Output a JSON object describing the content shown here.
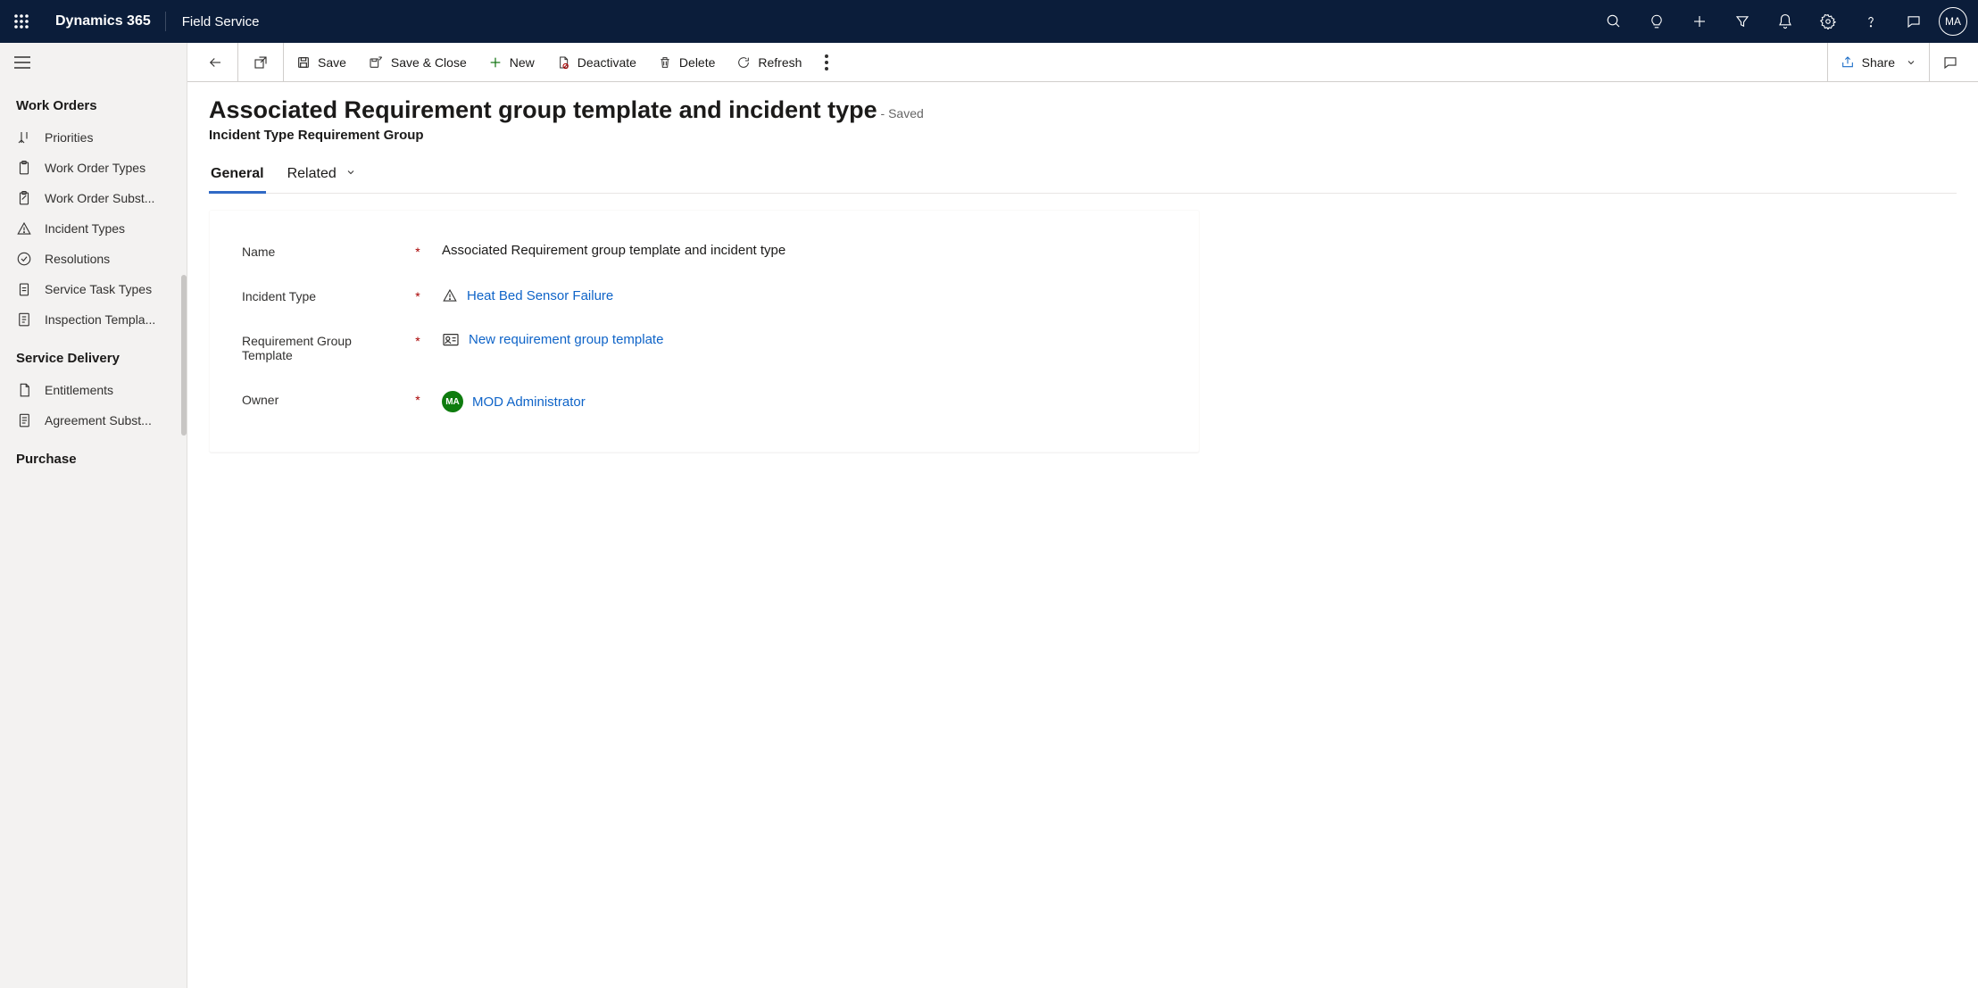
{
  "topnav": {
    "brand": "Dynamics 365",
    "module": "Field Service",
    "avatar_initials": "MA"
  },
  "commandBar": {
    "save": "Save",
    "saveClose": "Save & Close",
    "new": "New",
    "deactivate": "Deactivate",
    "delete": "Delete",
    "refresh": "Refresh",
    "share": "Share"
  },
  "sidebar": {
    "group1_title": "Work Orders",
    "items1": [
      {
        "label": "Priorities"
      },
      {
        "label": "Work Order Types"
      },
      {
        "label": "Work Order Subst..."
      },
      {
        "label": "Incident Types"
      },
      {
        "label": "Resolutions"
      },
      {
        "label": "Service Task Types"
      },
      {
        "label": "Inspection Templa..."
      }
    ],
    "group2_title": "Service Delivery",
    "items2": [
      {
        "label": "Entitlements"
      },
      {
        "label": "Agreement Subst..."
      }
    ],
    "group3_title": "Purchase"
  },
  "page": {
    "title": "Associated Requirement group template and incident type",
    "saved_suffix": "- Saved",
    "subtitle": "Incident Type Requirement Group",
    "tab_general": "General",
    "tab_related": "Related",
    "fields": {
      "name_label": "Name",
      "name_value": "Associated Requirement group template and incident type",
      "incident_label": "Incident Type",
      "incident_value": "Heat Bed Sensor Failure",
      "reqgroup_label": "Requirement Group Template",
      "reqgroup_value": "New requirement group template",
      "owner_label": "Owner",
      "owner_value": "MOD Administrator",
      "owner_initials": "MA"
    }
  }
}
